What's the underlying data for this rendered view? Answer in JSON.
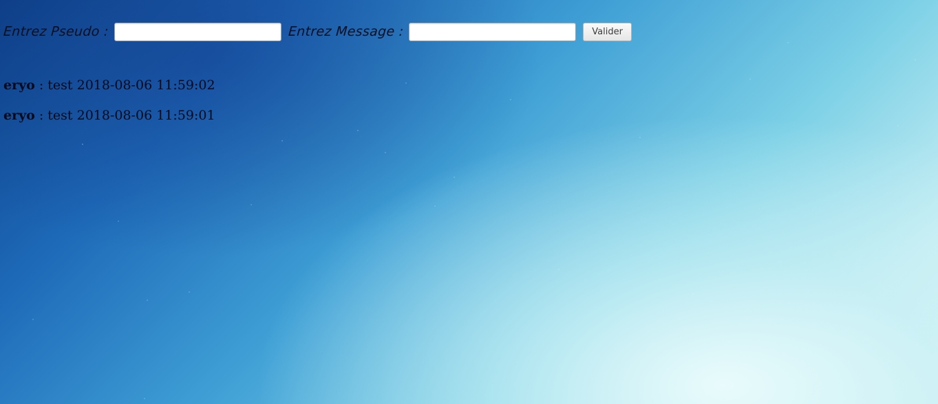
{
  "form": {
    "pseudo_label": "Entrez Pseudo :",
    "pseudo_value": "",
    "message_label": "Entrez Message :",
    "message_value": "",
    "submit_label": "Valider"
  },
  "messages": [
    {
      "author": "eryo",
      "separator": " : ",
      "text": "test",
      "timestamp": "2018-08-06 11:59:02"
    },
    {
      "author": "eryo",
      "separator": " : ",
      "text": "test",
      "timestamp": "2018-08-06 11:59:01"
    }
  ],
  "colors": {
    "background_top": "#0d3f86",
    "background_bottom": "#e2f8f8",
    "text": "#050a1c"
  }
}
